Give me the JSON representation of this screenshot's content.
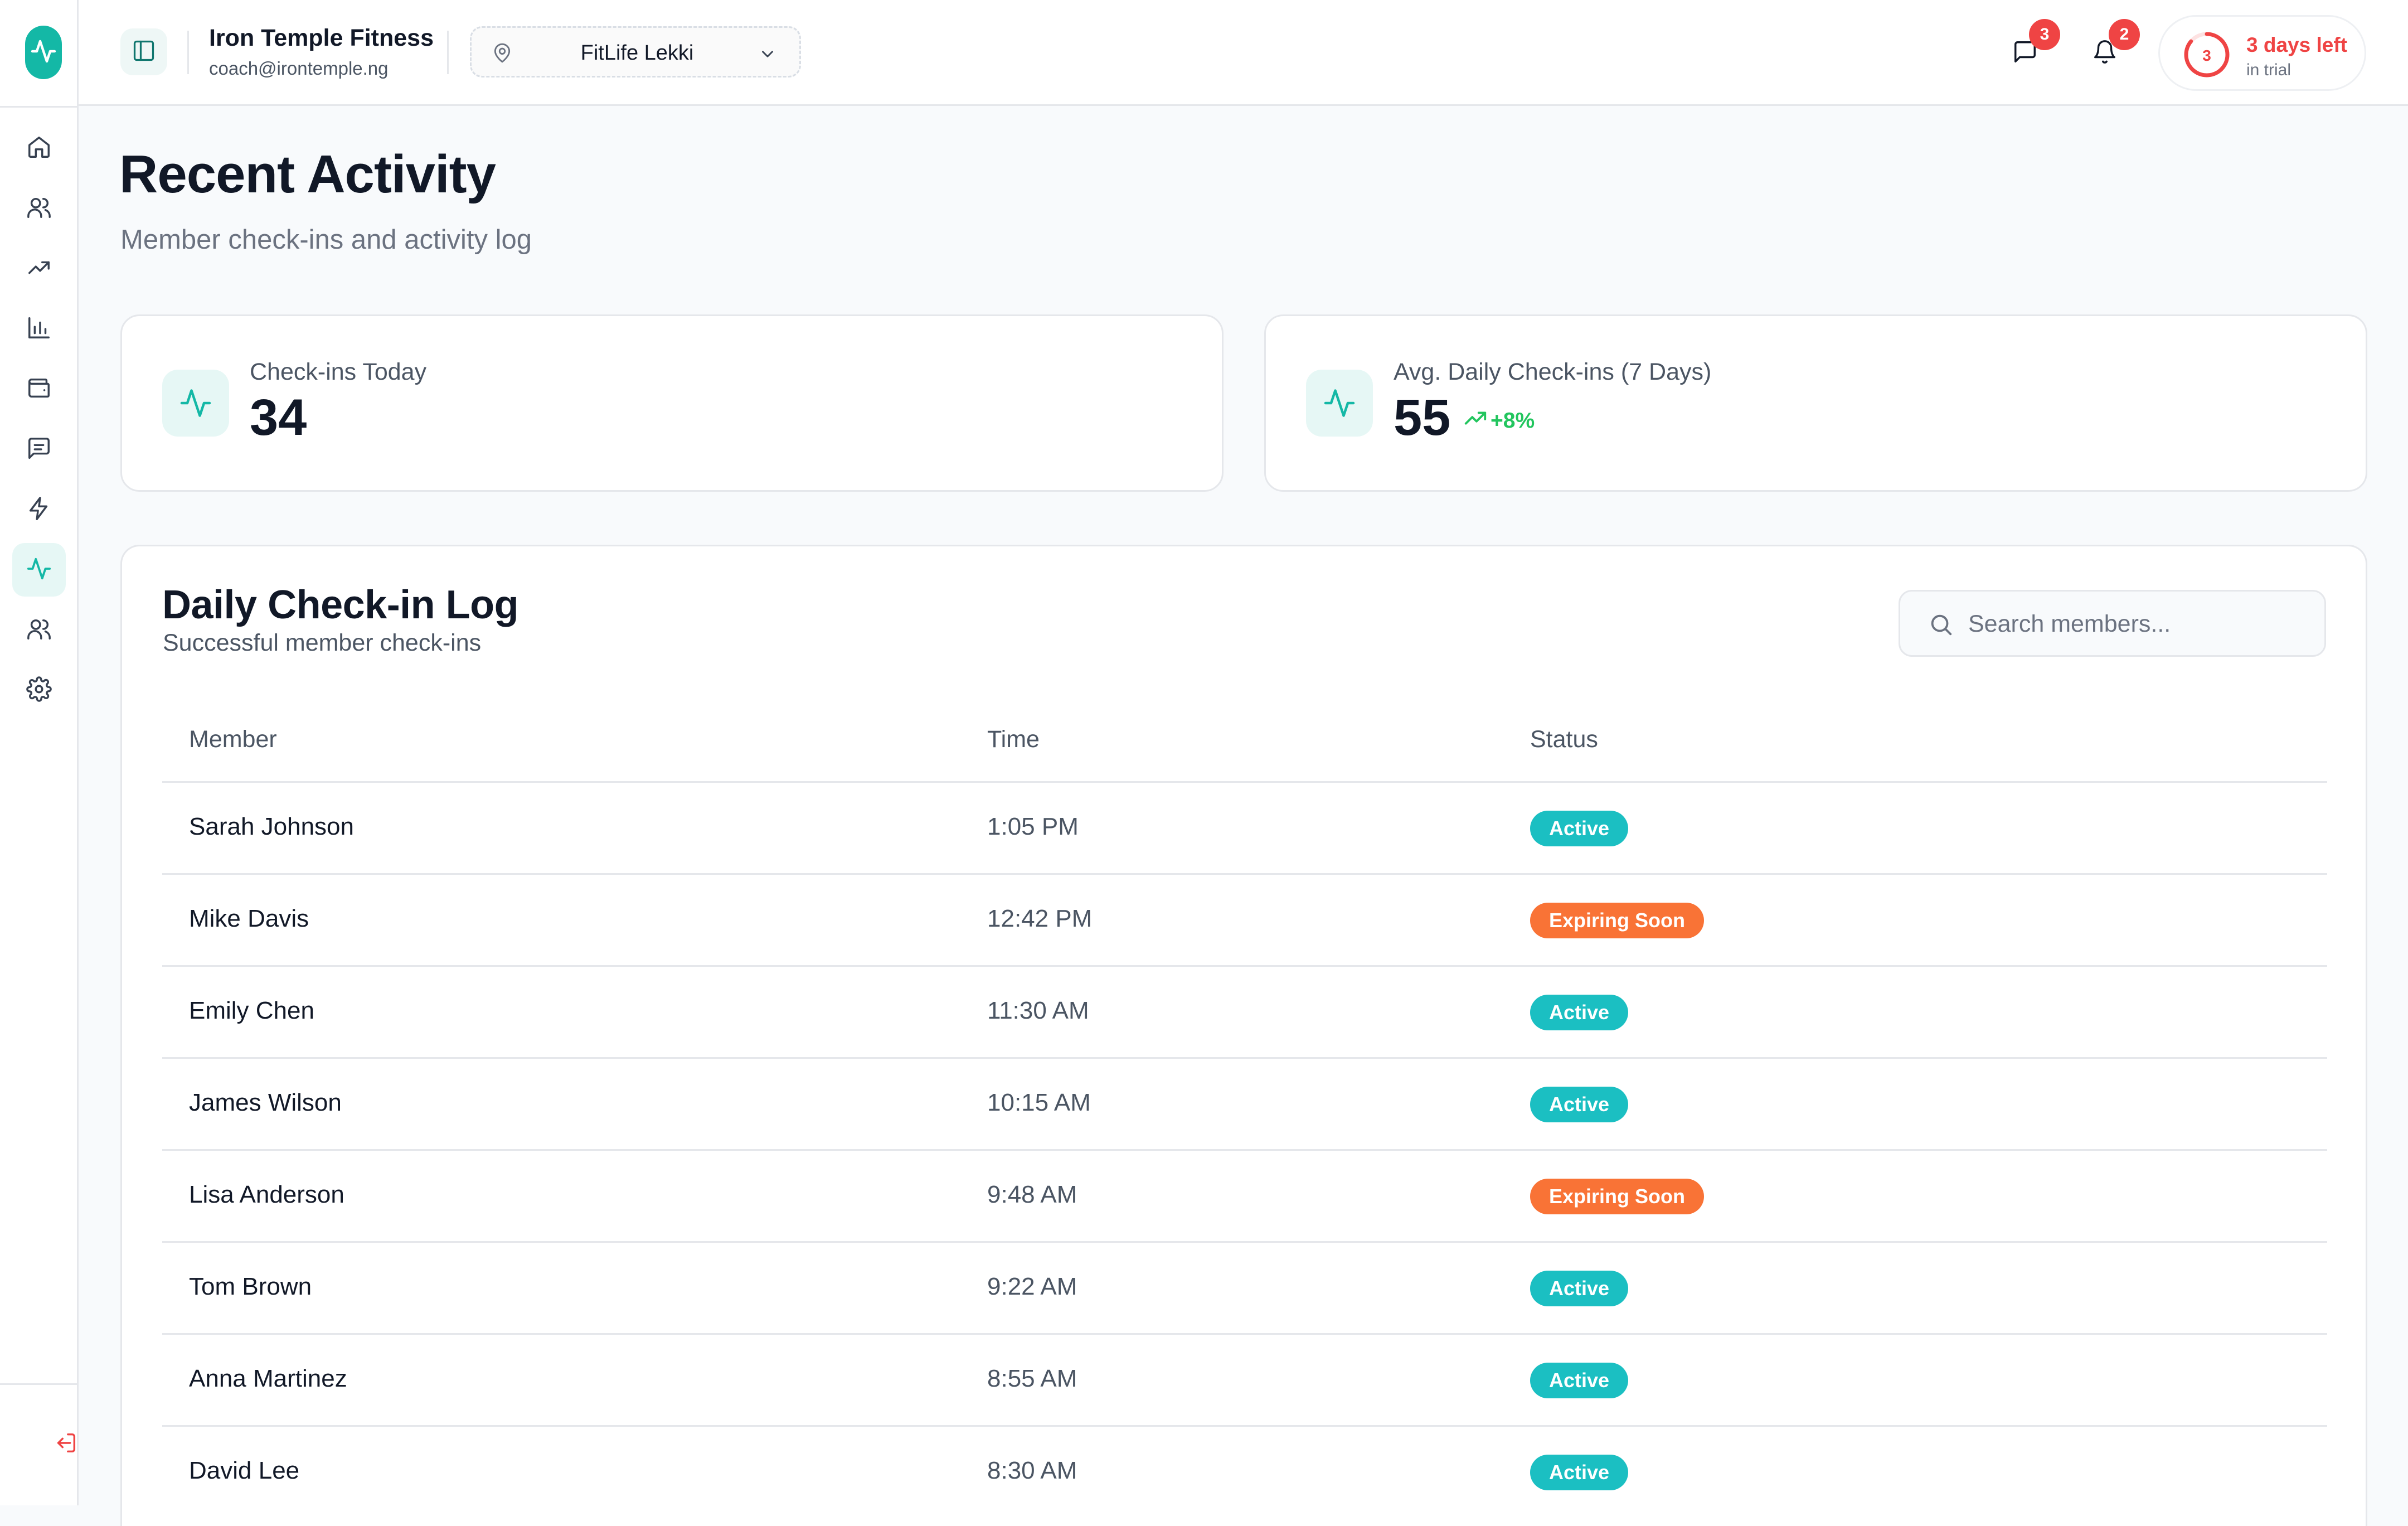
{
  "app": {
    "org_name": "Iron Temple Fitness",
    "org_email": "coach@irontemple.ng",
    "location": "FitLife Lekki"
  },
  "header": {
    "messages_badge": "3",
    "notifications_badge": "2",
    "trial_ring_value": "3",
    "trial_days": "3 days left",
    "trial_sub": "in trial"
  },
  "sidebar": {
    "items": [
      {
        "name": "home",
        "icon": "home-icon",
        "active": false
      },
      {
        "name": "members",
        "icon": "users-icon",
        "active": false
      },
      {
        "name": "growth",
        "icon": "trending-up-icon",
        "active": false
      },
      {
        "name": "reports",
        "icon": "bar-chart-icon",
        "active": false
      },
      {
        "name": "payments",
        "icon": "wallet-icon",
        "active": false
      },
      {
        "name": "messages",
        "icon": "message-icon",
        "active": false
      },
      {
        "name": "automations",
        "icon": "bolt-icon",
        "active": false
      },
      {
        "name": "activity",
        "icon": "activity-icon",
        "active": true
      },
      {
        "name": "staff",
        "icon": "team-icon",
        "active": false
      },
      {
        "name": "settings",
        "icon": "gear-icon",
        "active": false
      }
    ]
  },
  "page": {
    "title": "Recent Activity",
    "subtitle": "Member check-ins and activity log"
  },
  "stats": [
    {
      "label": "Check-ins Today",
      "value": "34"
    },
    {
      "label": "Avg. Daily Check-ins (7 Days)",
      "value": "55",
      "trend": "+8%"
    }
  ],
  "log": {
    "title": "Daily Check-in Log",
    "subtitle": "Successful member check-ins",
    "search_placeholder": "Search members...",
    "columns": [
      "Member",
      "Time",
      "Status"
    ],
    "rows": [
      {
        "member": "Sarah Johnson",
        "time": "1:05 PM",
        "status": "Active"
      },
      {
        "member": "Mike Davis",
        "time": "12:42 PM",
        "status": "Expiring Soon"
      },
      {
        "member": "Emily Chen",
        "time": "11:30 AM",
        "status": "Active"
      },
      {
        "member": "James Wilson",
        "time": "10:15 AM",
        "status": "Active"
      },
      {
        "member": "Lisa Anderson",
        "time": "9:48 AM",
        "status": "Expiring Soon"
      },
      {
        "member": "Tom Brown",
        "time": "9:22 AM",
        "status": "Active"
      },
      {
        "member": "Anna Martinez",
        "time": "8:55 AM",
        "status": "Active"
      },
      {
        "member": "David Lee",
        "time": "8:30 AM",
        "status": "Active"
      }
    ]
  },
  "colors": {
    "accent": "#14b8a6",
    "active_status": "#1bbfc2",
    "expiring_status": "#f97336",
    "danger": "#ef4444",
    "trend_up": "#22c55e"
  }
}
